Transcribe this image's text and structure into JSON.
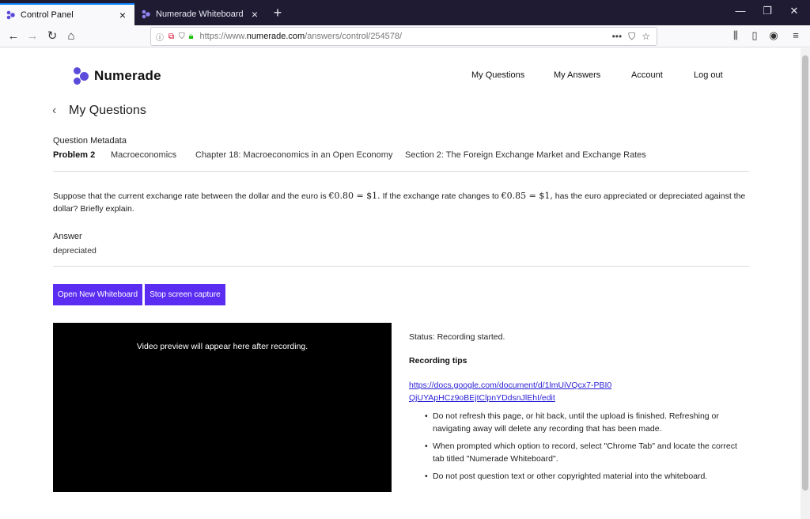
{
  "browser": {
    "tabs": [
      {
        "title": "Control Panel",
        "active": true
      },
      {
        "title": "Numerade Whiteboard",
        "active": false
      }
    ],
    "url_prefix": "https://www.",
    "url_domain": "numerade.com",
    "url_path": "/answers/control/254578/"
  },
  "site": {
    "brand": "Numerade",
    "nav": [
      "My Questions",
      "My Answers",
      "Account",
      "Log out"
    ]
  },
  "page": {
    "title": "My Questions",
    "metadata_heading": "Question Metadata",
    "metadata": {
      "problem": "Problem 2",
      "subject": "Macroeconomics",
      "chapter": "Chapter 18: Macroeconomics in an Open Economy",
      "section": "Section 2: The Foreign Exchange Market and Exchange Rates"
    },
    "question": {
      "part1": "Suppose that the current exchange rate between the dollar and the euro is ",
      "math1": "€0.80 = $1.",
      "part2": " If the exchange rate changes to ",
      "math2": "€0.85 = $1,",
      "part3": " has the euro appreciated or depreciated against the dollar? Briefly explain."
    },
    "answer_heading": "Answer",
    "answer": "depreciated",
    "buttons": {
      "open_whiteboard": "Open New Whiteboard",
      "stop_capture": "Stop screen capture"
    },
    "video_placeholder": "Video preview will appear here after recording.",
    "status": "Status: Recording started.",
    "tips_heading": "Recording tips",
    "tips_link": "https://docs.google.com/document/d/1lmUiVQcx7-PBI0QjUYApHCz9oBEjtClpnYDdsnJlEhI/edit",
    "tips": [
      "Do not refresh this page, or hit back, until the upload is finished. Refreshing or navigating away will delete any recording that has been made.",
      "When prompted which option to record, select \"Chrome Tab\" and locate the correct tab titled \"Numerade Whiteboard\".",
      "Do not post question text or other copyrighted material into the whiteboard."
    ]
  },
  "colors": {
    "accent": "#5b2df2",
    "brand": "#5b4bdb",
    "link": "#2a1fd6"
  }
}
